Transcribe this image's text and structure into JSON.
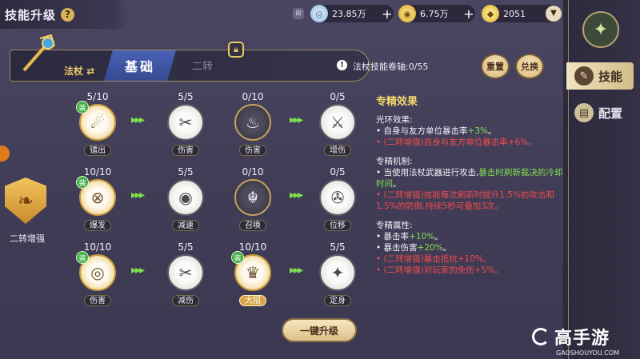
{
  "header": {
    "title": "技能升级",
    "help_icon": "?"
  },
  "resources": [
    {
      "icon": "crystal-icon",
      "value": "23.85万"
    },
    {
      "icon": "gold-coin-icon",
      "value": "6.75万"
    },
    {
      "icon": "gem-icon",
      "value": "2051"
    }
  ],
  "sidebar": {
    "tabs": [
      {
        "label": "技能",
        "active": true
      },
      {
        "label": "配置",
        "active": false
      }
    ]
  },
  "weapon": {
    "name": "法杖"
  },
  "tabs": [
    {
      "label": "基础",
      "active": true
    },
    {
      "label": "二转",
      "locked": true
    }
  ],
  "scroll_info": "法杖技能卷轴:0/55",
  "buttons": {
    "reset": "重置",
    "swap": "兑换",
    "upgrade_all": "一键升级"
  },
  "boost": {
    "label": "二转增强"
  },
  "equip_badge": "装",
  "skills": [
    {
      "count": "5/10",
      "name": "镭出",
      "style": "gold",
      "equipped": true,
      "highlight": false
    },
    {
      "count": "5/5",
      "name": "伤害",
      "style": "light",
      "equipped": false,
      "highlight": false
    },
    {
      "count": "0/10",
      "name": "伤害",
      "style": "dark",
      "equipped": false,
      "highlight": false
    },
    {
      "count": "0/5",
      "name": "增伤",
      "style": "light",
      "equipped": false,
      "highlight": false
    },
    {
      "count": "10/10",
      "name": "爆发",
      "style": "gold",
      "equipped": true,
      "highlight": false
    },
    {
      "count": "5/5",
      "name": "减速",
      "style": "light",
      "equipped": false,
      "highlight": false
    },
    {
      "count": "0/10",
      "name": "召唤",
      "style": "dark",
      "equipped": false,
      "highlight": false
    },
    {
      "count": "0/5",
      "name": "位移",
      "style": "light",
      "equipped": false,
      "highlight": false
    },
    {
      "count": "10/10",
      "name": "伤害",
      "style": "gold",
      "equipped": true,
      "highlight": false
    },
    {
      "count": "5/5",
      "name": "减伤",
      "style": "light",
      "equipped": false,
      "highlight": false
    },
    {
      "count": "10/10",
      "name": "大招",
      "style": "gold",
      "equipped": true,
      "highlight": true
    },
    {
      "count": "5/5",
      "name": "定身",
      "style": "light",
      "equipped": false,
      "highlight": false
    }
  ],
  "description": {
    "heading": "专精效果",
    "sections": [
      {
        "title": "光环效果:",
        "lines": [
          {
            "text": "• 自身与友方单位暴击率",
            "green": "+3%",
            "after": "。",
            "red": false
          },
          {
            "text": "• (二转增强)自身与友方单位暴击率+6%。",
            "green": "",
            "after": "",
            "red": true
          }
        ]
      },
      {
        "title": "专精机制:",
        "lines": [
          {
            "text": "• 当使用法杖武器进行攻击,",
            "green": "暴击时刷新裁决的冷却时间",
            "after": "。",
            "red": false
          },
          {
            "text": "• (二转增强)技能每次刷新时提升1.5%的攻击和1.5%的防御,持续5秒可叠加3次。",
            "green": "",
            "after": "",
            "red": true
          }
        ]
      },
      {
        "title": "专精属性:",
        "lines": [
          {
            "text": "• 暴击率",
            "green": "+10%",
            "after": "。",
            "red": false
          },
          {
            "text": "• 暴击伤害",
            "green": "+20%",
            "after": "。",
            "red": false
          },
          {
            "text": "• (二转增强)暴击抵抗+10%。",
            "green": "",
            "after": "",
            "red": true
          },
          {
            "text": "• (二转增强)对玩家的免伤+5%。",
            "green": "",
            "after": "",
            "red": true
          }
        ]
      }
    ]
  },
  "watermark": {
    "brand": "高手游",
    "url": "GAOSHOUYOU.COM"
  }
}
